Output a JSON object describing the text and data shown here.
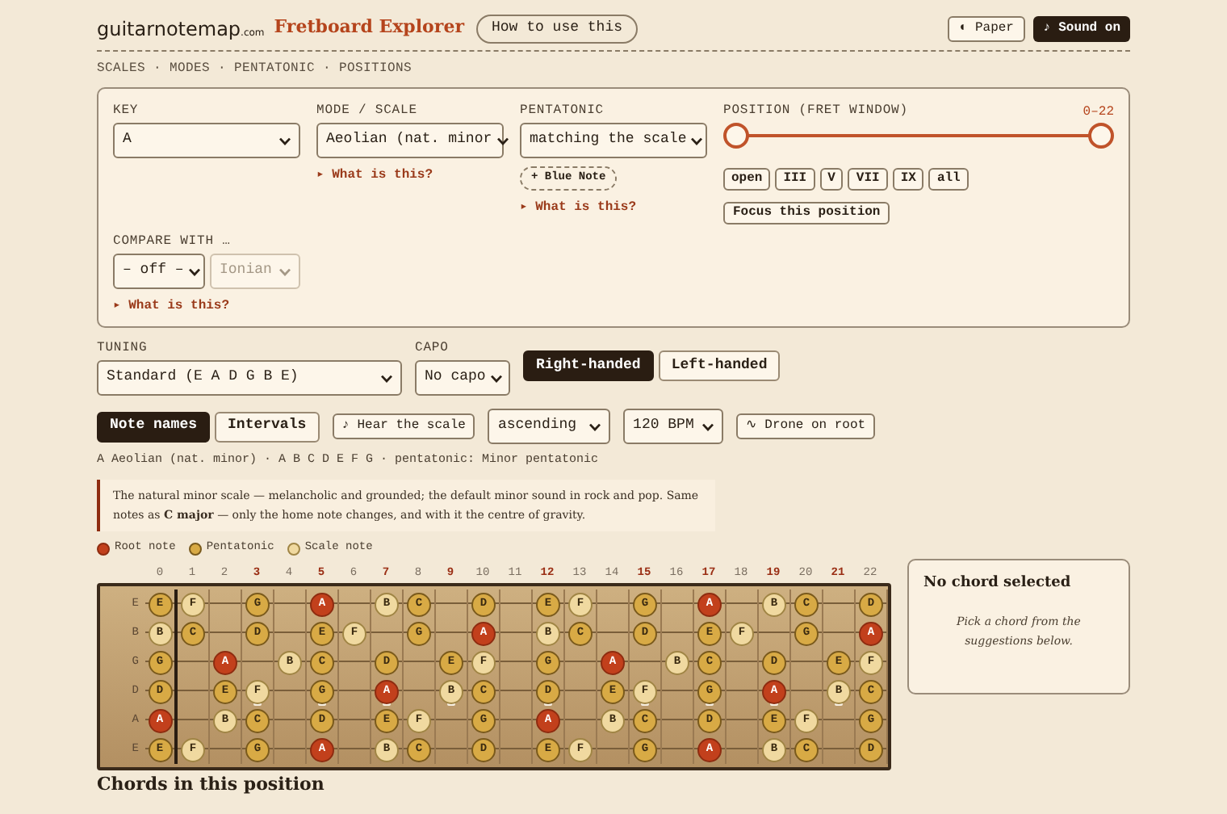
{
  "header": {
    "logo": {
      "name": "guitarnotemap",
      "suffix": ".com"
    },
    "title": "Fretboard Explorer",
    "help_button": "How to use this",
    "theme_button": "◐ Paper",
    "sound_button": "♪ Sound on"
  },
  "breadcrumbs": "SCALES · MODES · PENTATONIC · POSITIONS",
  "controls": {
    "key": {
      "label": "KEY",
      "value": "A"
    },
    "mode": {
      "label": "MODE / SCALE",
      "value": "Aeolian (nat. minor",
      "link": "▸ What is this?"
    },
    "pentatonic": {
      "label": "PENTATONIC",
      "value": "matching the scale",
      "chip": "+ Blue Note",
      "link": "▸ What is this?"
    },
    "position": {
      "label": "POSITION (FRET WINDOW)",
      "reading": "0–22",
      "thumbs": [
        {
          "level": 0
        },
        {
          "level": 1
        }
      ],
      "buttons": [
        "open",
        "III",
        "V",
        "VII",
        "IX",
        "all"
      ],
      "focus_button": "Focus this position"
    },
    "compare": {
      "label": "COMPARE WITH …",
      "value": "– off –",
      "second_value": "Ionian",
      "second_disabled": true,
      "link": "▸ What is this?"
    }
  },
  "tuning": {
    "label": "TUNING",
    "value": "Standard (E A D G B E)"
  },
  "capo": {
    "label": "CAPO",
    "value": "No capo"
  },
  "handedness": [
    {
      "label": "Right-handed",
      "selected": true
    },
    {
      "label": "Left-handed",
      "selected": false
    }
  ],
  "display_modes": [
    {
      "label": "Note names",
      "selected": true
    },
    {
      "label": "Intervals",
      "selected": false
    }
  ],
  "play": {
    "hear_button": "♪ Hear the scale",
    "direction": "ascending",
    "tempo": "120 BPM",
    "drone_button": "∿ Drone on root"
  },
  "summary": "A Aeolian (nat. minor) · A B C D E F G · pentatonic: Minor pentatonic",
  "description": "The natural minor scale — melancholic and grounded; the default minor sound in rock and pop. Same notes as **C major** — only the home note changes, and with it the centre of gravity.",
  "legend": [
    {
      "label": "Root note",
      "kind": "root"
    },
    {
      "label": "Pentatonic",
      "kind": "pentatonic"
    },
    {
      "label": "Scale note",
      "kind": "scale"
    }
  ],
  "frets": [
    {
      "label": "0",
      "marked": false
    },
    {
      "label": "1",
      "marked": false
    },
    {
      "label": "2",
      "marked": false
    },
    {
      "label": "3",
      "marked": true
    },
    {
      "label": "4",
      "marked": false
    },
    {
      "label": "5",
      "marked": true
    },
    {
      "label": "6",
      "marked": false
    },
    {
      "label": "7",
      "marked": true
    },
    {
      "label": "8",
      "marked": false
    },
    {
      "label": "9",
      "marked": true
    },
    {
      "label": "10",
      "marked": false
    },
    {
      "label": "11",
      "marked": false
    },
    {
      "label": "12",
      "marked": true
    },
    {
      "label": "13",
      "marked": false
    },
    {
      "label": "14",
      "marked": false
    },
    {
      "label": "15",
      "marked": true
    },
    {
      "label": "16",
      "marked": false
    },
    {
      "label": "17",
      "marked": true
    },
    {
      "label": "18",
      "marked": false
    },
    {
      "label": "19",
      "marked": true
    },
    {
      "label": "20",
      "marked": false
    },
    {
      "label": "21",
      "marked": true
    },
    {
      "label": "22",
      "marked": false
    }
  ],
  "strings": [
    {
      "label": "E",
      "notes": [
        {
          "note": "E",
          "kind": "pentatonic"
        },
        {
          "note": "F",
          "kind": "scale"
        },
        {
          "kind": "empty"
        },
        {
          "note": "G",
          "kind": "pentatonic"
        },
        {
          "kind": "empty"
        },
        {
          "note": "A",
          "kind": "root"
        },
        {
          "kind": "empty"
        },
        {
          "note": "B",
          "kind": "scale"
        },
        {
          "note": "C",
          "kind": "pentatonic"
        },
        {
          "kind": "empty"
        },
        {
          "note": "D",
          "kind": "pentatonic"
        },
        {
          "kind": "empty"
        },
        {
          "note": "E",
          "kind": "pentatonic"
        },
        {
          "note": "F",
          "kind": "scale"
        },
        {
          "kind": "empty"
        },
        {
          "note": "G",
          "kind": "pentatonic"
        },
        {
          "kind": "empty"
        },
        {
          "note": "A",
          "kind": "root"
        },
        {
          "kind": "empty"
        },
        {
          "note": "B",
          "kind": "scale"
        },
        {
          "note": "C",
          "kind": "pentatonic"
        },
        {
          "kind": "empty"
        },
        {
          "note": "D",
          "kind": "pentatonic"
        }
      ]
    },
    {
      "label": "B",
      "notes": [
        {
          "note": "B",
          "kind": "scale"
        },
        {
          "note": "C",
          "kind": "pentatonic"
        },
        {
          "kind": "empty"
        },
        {
          "note": "D",
          "kind": "pentatonic"
        },
        {
          "kind": "empty"
        },
        {
          "note": "E",
          "kind": "pentatonic"
        },
        {
          "note": "F",
          "kind": "scale"
        },
        {
          "kind": "empty"
        },
        {
          "note": "G",
          "kind": "pentatonic"
        },
        {
          "kind": "empty"
        },
        {
          "note": "A",
          "kind": "root"
        },
        {
          "kind": "empty"
        },
        {
          "note": "B",
          "kind": "scale"
        },
        {
          "note": "C",
          "kind": "pentatonic"
        },
        {
          "kind": "empty"
        },
        {
          "note": "D",
          "kind": "pentatonic"
        },
        {
          "kind": "empty"
        },
        {
          "note": "E",
          "kind": "pentatonic"
        },
        {
          "note": "F",
          "kind": "scale"
        },
        {
          "kind": "empty"
        },
        {
          "note": "G",
          "kind": "pentatonic"
        },
        {
          "kind": "empty"
        },
        {
          "note": "A",
          "kind": "root"
        }
      ]
    },
    {
      "label": "G",
      "notes": [
        {
          "note": "G",
          "kind": "pentatonic"
        },
        {
          "kind": "empty"
        },
        {
          "note": "A",
          "kind": "root"
        },
        {
          "kind": "empty"
        },
        {
          "note": "B",
          "kind": "scale"
        },
        {
          "note": "C",
          "kind": "pentatonic"
        },
        {
          "kind": "empty"
        },
        {
          "note": "D",
          "kind": "pentatonic"
        },
        {
          "kind": "empty"
        },
        {
          "note": "E",
          "kind": "pentatonic"
        },
        {
          "note": "F",
          "kind": "scale"
        },
        {
          "kind": "empty"
        },
        {
          "note": "G",
          "kind": "pentatonic"
        },
        {
          "kind": "empty"
        },
        {
          "note": "A",
          "kind": "root"
        },
        {
          "kind": "empty"
        },
        {
          "note": "B",
          "kind": "scale"
        },
        {
          "note": "C",
          "kind": "pentatonic"
        },
        {
          "kind": "empty"
        },
        {
          "note": "D",
          "kind": "pentatonic"
        },
        {
          "kind": "empty"
        },
        {
          "note": "E",
          "kind": "pentatonic"
        },
        {
          "note": "F",
          "kind": "scale"
        }
      ]
    },
    {
      "label": "D",
      "notes": [
        {
          "note": "D",
          "kind": "pentatonic"
        },
        {
          "kind": "empty"
        },
        {
          "note": "E",
          "kind": "pentatonic"
        },
        {
          "note": "F",
          "kind": "scale"
        },
        {
          "kind": "empty"
        },
        {
          "note": "G",
          "kind": "pentatonic"
        },
        {
          "kind": "empty"
        },
        {
          "note": "A",
          "kind": "root"
        },
        {
          "kind": "empty"
        },
        {
          "note": "B",
          "kind": "scale"
        },
        {
          "note": "C",
          "kind": "pentatonic"
        },
        {
          "kind": "empty"
        },
        {
          "note": "D",
          "kind": "pentatonic"
        },
        {
          "kind": "empty"
        },
        {
          "note": "E",
          "kind": "pentatonic"
        },
        {
          "note": "F",
          "kind": "scale"
        },
        {
          "kind": "empty"
        },
        {
          "note": "G",
          "kind": "pentatonic"
        },
        {
          "kind": "empty"
        },
        {
          "note": "A",
          "kind": "root"
        },
        {
          "kind": "empty"
        },
        {
          "note": "B",
          "kind": "scale"
        },
        {
          "note": "C",
          "kind": "pentatonic"
        }
      ]
    },
    {
      "label": "A",
      "notes": [
        {
          "note": "A",
          "kind": "root"
        },
        {
          "kind": "empty"
        },
        {
          "note": "B",
          "kind": "scale"
        },
        {
          "note": "C",
          "kind": "pentatonic"
        },
        {
          "kind": "empty"
        },
        {
          "note": "D",
          "kind": "pentatonic"
        },
        {
          "kind": "empty"
        },
        {
          "note": "E",
          "kind": "pentatonic"
        },
        {
          "note": "F",
          "kind": "scale"
        },
        {
          "kind": "empty"
        },
        {
          "note": "G",
          "kind": "pentatonic"
        },
        {
          "kind": "empty"
        },
        {
          "note": "A",
          "kind": "root"
        },
        {
          "kind": "empty"
        },
        {
          "note": "B",
          "kind": "scale"
        },
        {
          "note": "C",
          "kind": "pentatonic"
        },
        {
          "kind": "empty"
        },
        {
          "note": "D",
          "kind": "pentatonic"
        },
        {
          "kind": "empty"
        },
        {
          "note": "E",
          "kind": "pentatonic"
        },
        {
          "note": "F",
          "kind": "scale"
        },
        {
          "kind": "empty"
        },
        {
          "note": "G",
          "kind": "pentatonic"
        }
      ]
    },
    {
      "label": "E",
      "notes": [
        {
          "note": "E",
          "kind": "pentatonic"
        },
        {
          "note": "F",
          "kind": "scale"
        },
        {
          "kind": "empty"
        },
        {
          "note": "G",
          "kind": "pentatonic"
        },
        {
          "kind": "empty"
        },
        {
          "note": "A",
          "kind": "root"
        },
        {
          "kind": "empty"
        },
        {
          "note": "B",
          "kind": "scale"
        },
        {
          "note": "C",
          "kind": "pentatonic"
        },
        {
          "kind": "empty"
        },
        {
          "note": "D",
          "kind": "pentatonic"
        },
        {
          "kind": "empty"
        },
        {
          "note": "E",
          "kind": "pentatonic"
        },
        {
          "note": "F",
          "kind": "scale"
        },
        {
          "kind": "empty"
        },
        {
          "note": "G",
          "kind": "pentatonic"
        },
        {
          "kind": "empty"
        },
        {
          "note": "A",
          "kind": "root"
        },
        {
          "kind": "empty"
        },
        {
          "note": "B",
          "kind": "scale"
        },
        {
          "note": "C",
          "kind": "pentatonic"
        },
        {
          "kind": "empty"
        },
        {
          "note": "D",
          "kind": "pentatonic"
        }
      ]
    }
  ],
  "chord_card": {
    "title": "No chord selected",
    "hint": "Pick a chord from the suggestions below."
  },
  "chords_heading": "Chords in this position"
}
